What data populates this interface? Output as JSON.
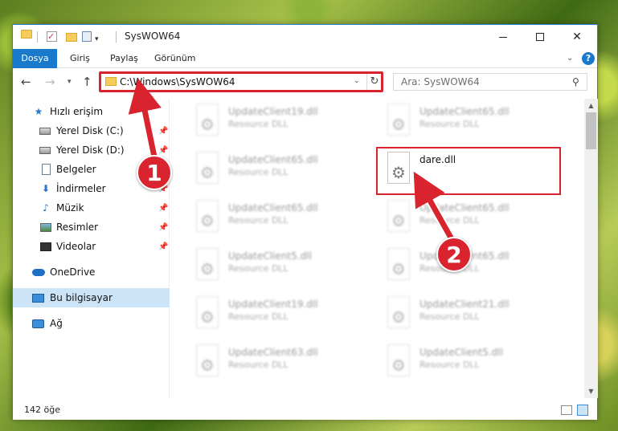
{
  "window": {
    "title": "SysWOW64",
    "minimize_icon": "minimize-icon",
    "maximize_icon": "maximize-icon",
    "close_label": "✕"
  },
  "ribbon": {
    "tabs": [
      {
        "label": "Dosya"
      },
      {
        "label": "Giriş"
      },
      {
        "label": "Paylaş"
      },
      {
        "label": "Görünüm"
      }
    ],
    "help_label": "?"
  },
  "address": {
    "path": "C:\\Windows\\SysWOW64",
    "refresh_icon": "refresh-icon"
  },
  "search": {
    "placeholder": "Ara: SysWOW64"
  },
  "sidebar": {
    "items": [
      {
        "label": "Hızlı erişim",
        "icon": "star-icon"
      },
      {
        "label": "Yerel Disk (C:)",
        "icon": "drive-icon"
      },
      {
        "label": "Yerel Disk (D:)",
        "icon": "drive-icon"
      },
      {
        "label": "Belgeler",
        "icon": "documents-icon"
      },
      {
        "label": "İndirmeler",
        "icon": "downloads-icon"
      },
      {
        "label": "Müzik",
        "icon": "music-icon"
      },
      {
        "label": "Resimler",
        "icon": "pictures-icon"
      },
      {
        "label": "Videolar",
        "icon": "videos-icon"
      },
      {
        "label": "OneDrive",
        "icon": "onedrive-icon"
      },
      {
        "label": "Bu bilgisayar",
        "icon": "this-pc-icon"
      },
      {
        "label": "Ağ",
        "icon": "network-icon"
      }
    ]
  },
  "files": [
    {
      "name": "UpdateClient19.dll",
      "type": "Resource DLL"
    },
    {
      "name": "UpdateClient65.dll",
      "type": "Resource DLL"
    },
    {
      "name": "UpdateClient65.dll",
      "type": "Resource DLL"
    },
    {
      "name": "dare.dll",
      "type": ""
    },
    {
      "name": "UpdateClient65.dll",
      "type": "Resource DLL"
    },
    {
      "name": "UpdateClient65.dll",
      "type": "Resource DLL"
    },
    {
      "name": "UpdateClient5.dll",
      "type": "Resource DLL"
    },
    {
      "name": "UpdateClient65.dll",
      "type": "Resource DLL"
    },
    {
      "name": "UpdateClient19.dll",
      "type": "Resource DLL"
    },
    {
      "name": "UpdateClient21.dll",
      "type": "Resource DLL"
    },
    {
      "name": "UpdateClient63.dll",
      "type": "Resource DLL"
    },
    {
      "name": "UpdateClient5.dll",
      "type": "Resource DLL"
    }
  ],
  "status": {
    "count": "142 öğe"
  },
  "annotations": {
    "step1": "1",
    "step2": "2",
    "color": "#d9232f"
  }
}
